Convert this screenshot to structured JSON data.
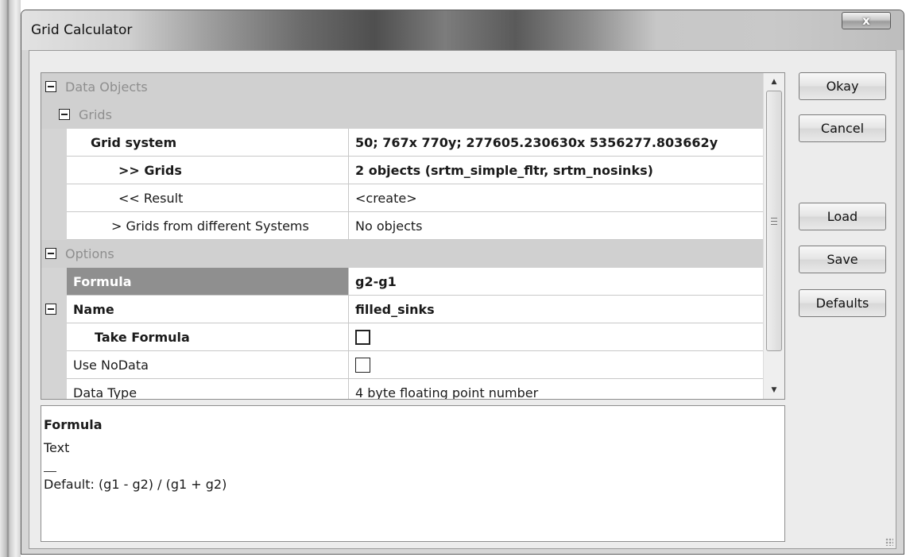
{
  "window": {
    "title": "Grid Calculator",
    "close_label": "x"
  },
  "grid": {
    "data_objects_label": "Data Objects",
    "grids_label": "Grids",
    "grid_system": {
      "name": "Grid system",
      "value": "50; 767x 770y; 277605.230630x 5356277.803662y"
    },
    "grids": {
      "name": ">> Grids",
      "value": "2 objects (srtm_simple_fltr, srtm_nosinks)"
    },
    "result": {
      "name": "<< Result",
      "value": "<create>"
    },
    "grids_other": {
      "name": "> Grids from different Systems",
      "value": "No objects"
    },
    "options_label": "Options",
    "formula": {
      "name": "Formula",
      "value": "g2-g1"
    },
    "name": {
      "name": "Name",
      "value": "filled_sinks"
    },
    "take_formula": {
      "name": "Take Formula",
      "checked": false
    },
    "use_nodata": {
      "name": "Use NoData",
      "checked": false
    },
    "data_type": {
      "name": "Data Type",
      "value": "4 byte floating point number"
    }
  },
  "description": {
    "title": "Formula",
    "type": "Text",
    "separator": "___",
    "default": "Default: (g1 - g2) / (g1 + g2)"
  },
  "buttons": {
    "okay": "Okay",
    "cancel": "Cancel",
    "load": "Load",
    "save": "Save",
    "defaults": "Defaults"
  },
  "icons": {
    "collapse": "minus-box-icon",
    "scroll_up": "arrow-up-icon",
    "scroll_down": "arrow-down-icon"
  },
  "colors": {
    "category_row": "#d0d0d0",
    "selected_name": "#8f8f8f",
    "category_text": "#8e8e8e"
  }
}
